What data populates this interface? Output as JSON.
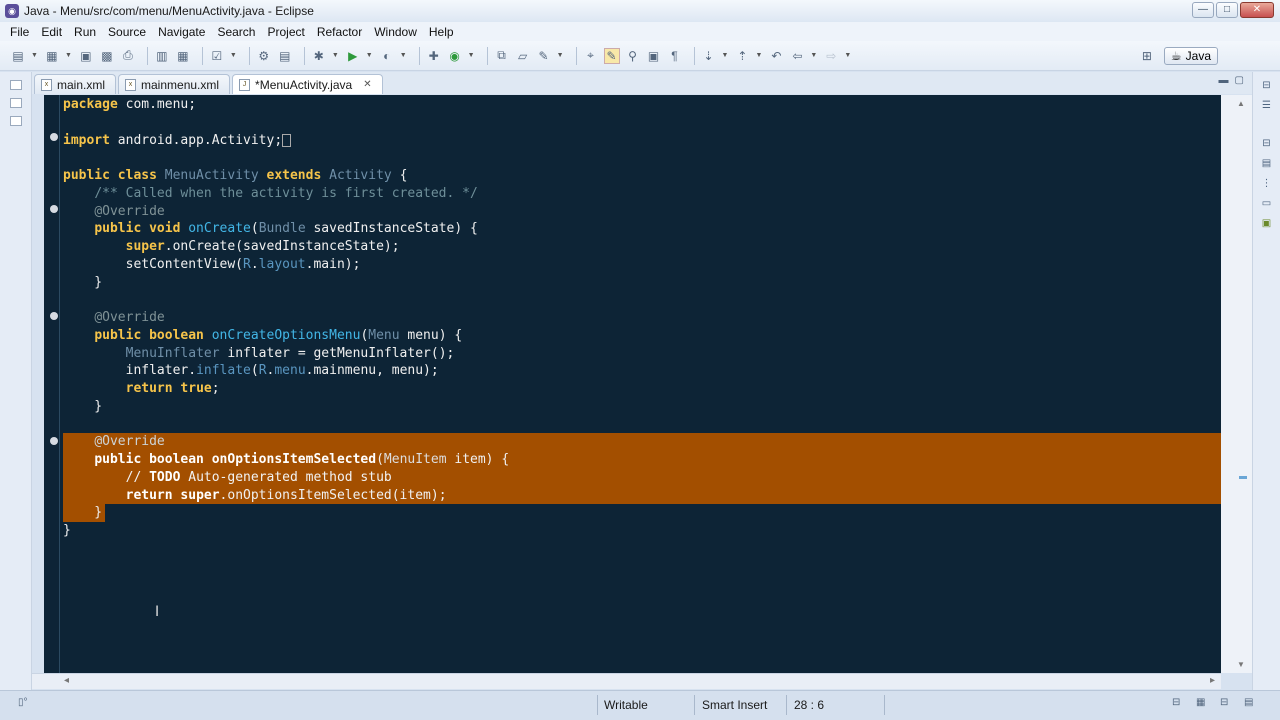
{
  "window": {
    "title": "Java - Menu/src/com/menu/MenuActivity.java - Eclipse",
    "app_icon": "eclipse-icon",
    "controls": [
      "minimize",
      "maximize",
      "close"
    ]
  },
  "menubar": {
    "items": [
      "File",
      "Edit",
      "Run",
      "Source",
      "Navigate",
      "Search",
      "Project",
      "Refactor",
      "Window",
      "Help"
    ]
  },
  "toolbar": {
    "perspective_label": "Java",
    "icons": [
      "new-icon",
      "save-icon",
      "save-all-icon",
      "print-icon",
      "build-icon",
      "debug-icon",
      "run-icon",
      "external-tools-icon",
      "new-java-project-icon",
      "new-class-icon",
      "open-type-icon",
      "search-icon",
      "toggle-mark-occurrences-icon",
      "next-annotation-icon",
      "previous-annotation-icon",
      "back-icon",
      "forward-icon"
    ]
  },
  "tabs": [
    {
      "label": "main.xml",
      "icon": "xml-file-icon",
      "active": false
    },
    {
      "label": "mainmenu.xml",
      "icon": "xml-file-icon",
      "active": false
    },
    {
      "label": "*MenuActivity.java",
      "icon": "java-file-icon",
      "active": true,
      "close": "✕"
    }
  ],
  "editor": {
    "highlight_color": "#a34f00",
    "background": "#0d2436",
    "lines": [
      "package com.menu;",
      "",
      "import android.app.Activity;",
      "",
      "public class MenuActivity extends Activity {",
      "    /** Called when the activity is first created. */",
      "    @Override",
      "    public void onCreate(Bundle savedInstanceState) {",
      "        super.onCreate(savedInstanceState);",
      "        setContentView(R.layout.main);",
      "    }",
      "",
      "    @Override",
      "    public boolean onCreateOptionsMenu(Menu menu) {",
      "        MenuInflater inflater = getMenuInflater();",
      "        inflater.inflate(R.menu.mainmenu, menu);",
      "        return true;",
      "    }",
      "",
      "    @Override",
      "    public boolean onOptionsItemSelected(MenuItem item) {",
      "        // TODO Auto-generated method stub",
      "        return super.onOptionsItemSelected(item);",
      "    }",
      "}"
    ]
  },
  "statusbar": {
    "writable": "Writable",
    "insert_mode": "Smart Insert",
    "position": "28 : 6"
  }
}
